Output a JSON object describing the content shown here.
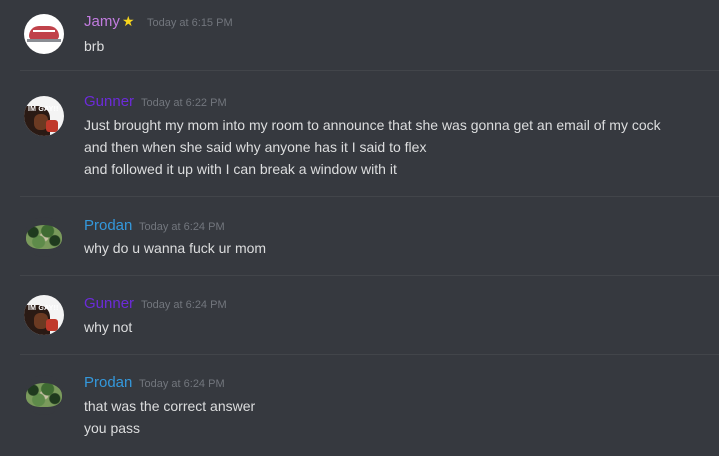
{
  "colors": {
    "background": "#36393f",
    "divider": "#42454a",
    "text": "#dcddde",
    "timestamp": "#72767d",
    "jamy": "#c27ce0",
    "gunner": "#6c2bd9",
    "prodan": "#3498db"
  },
  "messages": [
    {
      "author": "Jamy",
      "badge": "star-icon",
      "timestamp": "Today at 6:15 PM",
      "lines": [
        "brb"
      ]
    },
    {
      "author": "Gunner",
      "avatar_text": "IM GAY!!",
      "timestamp": "Today at 6:22 PM",
      "lines": [
        "Just brought my mom into my room to announce that she was gonna get an email of my cock",
        "and then when she said why anyone has it I said to flex",
        "and followed it up with I can break a window with it"
      ]
    },
    {
      "author": "Prodan",
      "timestamp": "Today at 6:24 PM",
      "lines": [
        "why do u wanna fuck ur mom"
      ]
    },
    {
      "author": "Gunner",
      "avatar_text": "IM GAY!!",
      "timestamp": "Today at 6:24 PM",
      "lines": [
        "why not"
      ]
    },
    {
      "author": "Prodan",
      "timestamp": "Today at 6:24 PM",
      "lines": [
        "that was the correct answer",
        "you pass"
      ]
    }
  ]
}
